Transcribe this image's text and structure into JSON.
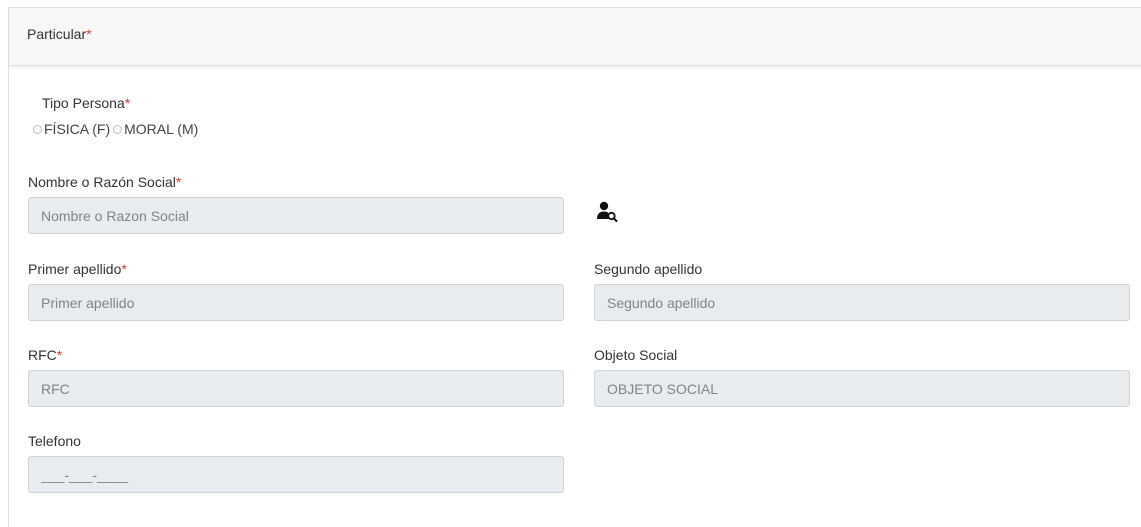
{
  "card": {
    "title": "Particular",
    "required_mark": "*"
  },
  "tipo_persona": {
    "label": "Tipo Persona",
    "required_mark": "*",
    "options": [
      {
        "label": "FÍSICA (F)",
        "selected": false
      },
      {
        "label": "MORAL (M)",
        "selected": false
      }
    ]
  },
  "nombre": {
    "label": "Nombre o Razón Social",
    "required_mark": "*",
    "placeholder": "Nombre o Razon Social",
    "value": "",
    "search_icon": "user-search-icon"
  },
  "primer_apellido": {
    "label": "Primer apellido",
    "required_mark": "*",
    "placeholder": "Primer apellido",
    "value": ""
  },
  "segundo_apellido": {
    "label": "Segundo apellido",
    "placeholder": "Segundo apellido",
    "value": ""
  },
  "rfc": {
    "label": "RFC",
    "required_mark": "*",
    "placeholder": "RFC",
    "value": ""
  },
  "objeto_social": {
    "label": "Objeto Social",
    "placeholder": "OBJETO SOCIAL",
    "value": ""
  },
  "telefono": {
    "label": "Telefono",
    "placeholder": "___-___-____",
    "value": ""
  },
  "colors": {
    "required": "#e3342f",
    "input_bg": "#e9ecef",
    "header_bg": "#f7f7f7"
  }
}
